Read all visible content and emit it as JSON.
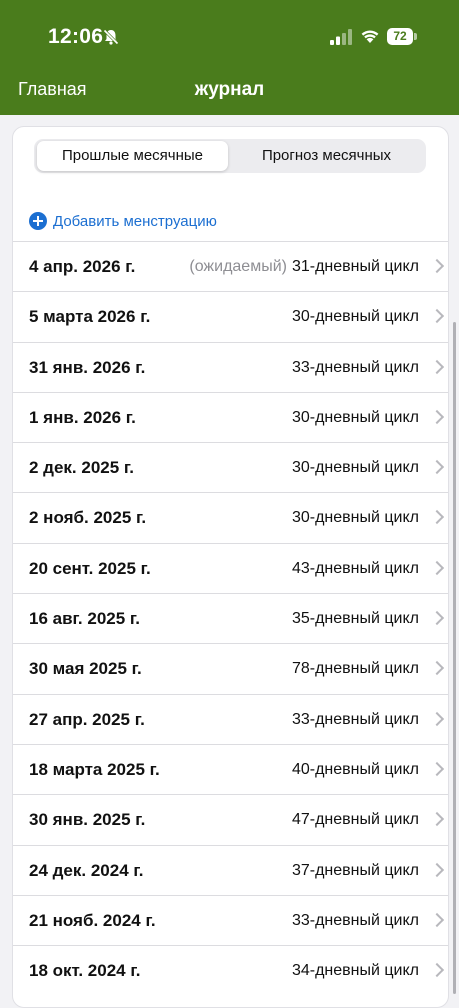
{
  "status_bar": {
    "time": "12:06",
    "battery": "72"
  },
  "nav": {
    "back_label": "Главная",
    "title": "журнал"
  },
  "segments": {
    "active": "Прошлые месячные",
    "inactive": "Прогноз месячных"
  },
  "add_label": "Добавить менструацию",
  "rows": [
    {
      "date": "4 апр. 2026 г.",
      "note": "(ожидаемый)",
      "cycle": "31-дневный цикл"
    },
    {
      "date": "5 марта 2026 г.",
      "note": "",
      "cycle": "30-дневный цикл"
    },
    {
      "date": "31 янв. 2026 г.",
      "note": "",
      "cycle": "33-дневный цикл"
    },
    {
      "date": "1 янв. 2026 г.",
      "note": "",
      "cycle": "30-дневный цикл"
    },
    {
      "date": "2 дек. 2025 г.",
      "note": "",
      "cycle": "30-дневный цикл"
    },
    {
      "date": "2 нояб. 2025 г.",
      "note": "",
      "cycle": "30-дневный цикл"
    },
    {
      "date": "20 сент. 2025 г.",
      "note": "",
      "cycle": "43-дневный цикл"
    },
    {
      "date": "16 авг. 2025 г.",
      "note": "",
      "cycle": "35-дневный цикл"
    },
    {
      "date": "30 мая 2025 г.",
      "note": "",
      "cycle": "78-дневный цикл"
    },
    {
      "date": "27 апр. 2025 г.",
      "note": "",
      "cycle": "33-дневный цикл"
    },
    {
      "date": "18 марта 2025 г.",
      "note": "",
      "cycle": "40-дневный цикл"
    },
    {
      "date": "30 янв. 2025 г.",
      "note": "",
      "cycle": "47-дневный цикл"
    },
    {
      "date": "24 дек. 2024 г.",
      "note": "",
      "cycle": "37-дневный цикл"
    },
    {
      "date": "21 нояб. 2024 г.",
      "note": "",
      "cycle": "33-дневный цикл"
    },
    {
      "date": "18 окт. 2024 г.",
      "note": "",
      "cycle": "34-дневный цикл"
    }
  ],
  "colors": {
    "header": "#4a7c1c",
    "accent": "#1c6fd1"
  },
  "icons": {
    "bell": "bell-muted-icon",
    "signal": "cellular-signal-icon",
    "wifi": "wifi-icon",
    "plus": "plus-circle-icon",
    "chevron": "chevron-right-icon"
  }
}
